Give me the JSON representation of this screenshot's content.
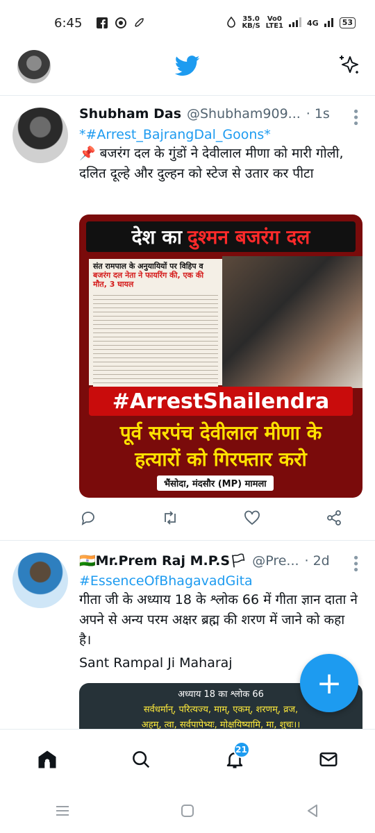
{
  "status_bar": {
    "time": "6:45",
    "net_speed": "35.0",
    "net_unit": "KB/S",
    "volte": "Vo0",
    "lte": "LTE1",
    "network": "4G",
    "battery": "53"
  },
  "topbar": {
    "logo_icon": "twitter-bird-icon",
    "sparkle_icon": "sparkle-icon"
  },
  "tweets": [
    {
      "name": "Shubham Das",
      "handle": "@Shubham909...",
      "dot": "·",
      "time": "1s",
      "hashtag": "*#Arrest_BajrangDal_Goons*",
      "text": "बजरंग दल के गुंडों ने देवीलाल मीणा को मारी गोली, दलित दूल्हे और दुल्हन को स्टेज से उतार कर पीटा",
      "poster": {
        "title_prefix": "देश का",
        "title_highlight": "दुश्मन बजरंग दल",
        "news_headline_a": "संत रामपाल के अनुयायियों पर विहिप व ",
        "news_headline_b": "बजरंग दल नेता ने फायरिंग की, एक की मौत, 3 घायल",
        "hashtag": "#ArrestShailendra",
        "line1": "पूर्व सरपंच देवीलाल मीणा के",
        "line2": "हत्यारों को गिरफ्तार करो",
        "place": "भैंसोदा, मंदसौर (MP) मामला"
      }
    },
    {
      "name": "🇮🇳Mr.Prem Raj M.P.S🏳",
      "handle": "@Pre...",
      "dot": "·",
      "time": "2d",
      "hashtag": "#EssenceOfBhagavadGita",
      "text": "गीता जी के अध्याय 18 के श्लोक 66 में गीता ज्ञान दाता ने अपने से अन्य परम अक्षर ब्रह्म की शरण में जाने को कहा है।",
      "signature": "Sant Rampal Ji Maharaj",
      "image": {
        "heading": "अध्याय 18 का श्लोक 66",
        "line1": "सर्वधर्मान्, परित्यज्य, माम्, एकम्, शरणम्, व्रज,",
        "line2": "अहम्, त्वा, सर्वपापेभ्यः, मोक्षयिष्यामि, मा, शुचः।।"
      }
    }
  ],
  "fab": {
    "label": "+"
  },
  "bottom_nav": {
    "notifications_badge": "21"
  }
}
